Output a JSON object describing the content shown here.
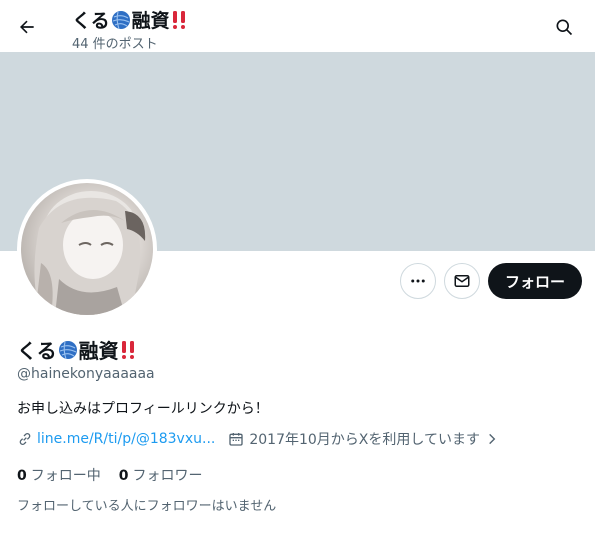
{
  "header": {
    "back_icon": "arrow-left-icon",
    "title_prefix": "くる",
    "title_suffix": "融資",
    "post_count": "44 件のポスト",
    "search_icon": "search-icon"
  },
  "profile": {
    "name_prefix": "くる",
    "name_suffix": "融資",
    "handle": "@hainekonyaaaaaa",
    "bio": "お申し込みはプロフィールリンクから！",
    "link": "line.me/R/ti/p/@183vxu...",
    "joined": "2017年10月からXを利用しています",
    "following_count": "0",
    "following_label": "フォロー中",
    "followers_count": "0",
    "followers_label": "フォロワー",
    "followed_by_note": "フォローしている人にフォロワーはいません"
  },
  "actions": {
    "more_icon": "more-icon",
    "message_icon": "mail-icon",
    "follow_label": "フォロー"
  },
  "colors": {
    "banner": "#cfd9de",
    "link": "#1d9bf0",
    "muted": "#536471",
    "follow_button": "#0f1419",
    "emoji_ball": "#2f6fc4",
    "emoji_bang": "#d9273a"
  }
}
